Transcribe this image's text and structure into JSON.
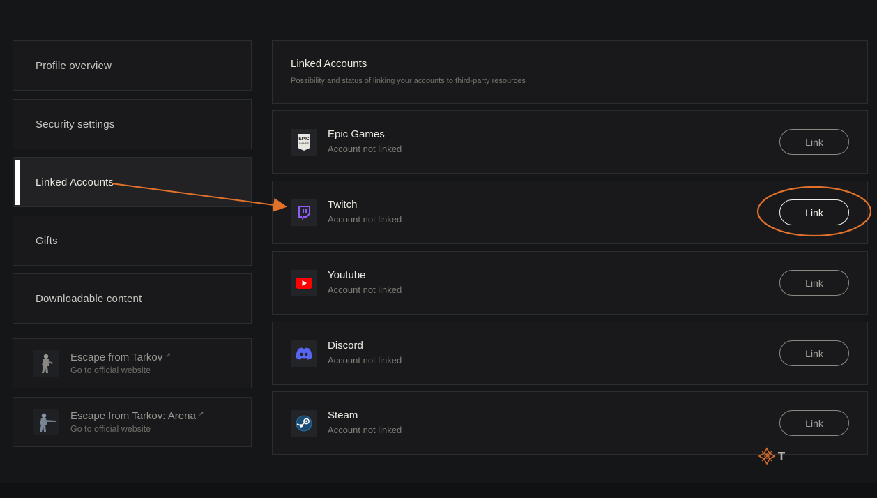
{
  "sidebar": {
    "items": [
      {
        "label": "Profile overview"
      },
      {
        "label": "Security settings"
      },
      {
        "label": "Linked Accounts"
      },
      {
        "label": "Gifts"
      },
      {
        "label": "Downloadable content"
      }
    ],
    "external": [
      {
        "title": "Escape from Tarkov",
        "subtitle": "Go to official website",
        "icon": "soldier-icon"
      },
      {
        "title": "Escape from Tarkov: Arena",
        "subtitle": "Go to official website",
        "icon": "soldier-aiming-icon"
      }
    ],
    "active_index": 2
  },
  "main": {
    "title": "Linked Accounts",
    "subtitle": "Possibility and status of linking your accounts to third-party resources",
    "accounts": [
      {
        "name": "Epic Games",
        "status": "Account not linked",
        "button": "Link",
        "icon": "epic-games-icon"
      },
      {
        "name": "Twitch",
        "status": "Account not linked",
        "button": "Link",
        "icon": "twitch-icon"
      },
      {
        "name": "Youtube",
        "status": "Account not linked",
        "button": "Link",
        "icon": "youtube-icon"
      },
      {
        "name": "Discord",
        "status": "Account not linked",
        "button": "Link",
        "icon": "discord-icon"
      },
      {
        "name": "Steam",
        "status": "Account not linked",
        "button": "Link",
        "icon": "steam-icon"
      }
    ]
  },
  "colors": {
    "background": "#151618",
    "card": "#19191b",
    "annotation": "#e2722a",
    "twitch": "#8f5cf5",
    "youtube": "#ff0000",
    "discord": "#5865f2"
  }
}
